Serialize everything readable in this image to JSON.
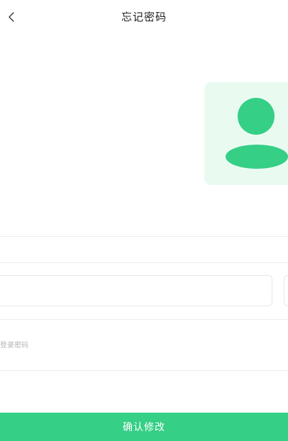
{
  "header": {
    "title": "忘记密码",
    "back_icon": "chevron-left-icon"
  },
  "avatar": {
    "icon": "user-avatar-icon",
    "bg_color": "#e9fbf1",
    "accent_color": "#35cf86"
  },
  "form": {
    "phone_value": "",
    "code_value": "",
    "password_placeholder": "登录密码"
  },
  "actions": {
    "confirm_label": "确认修改",
    "confirm_color": "#35cf86"
  }
}
